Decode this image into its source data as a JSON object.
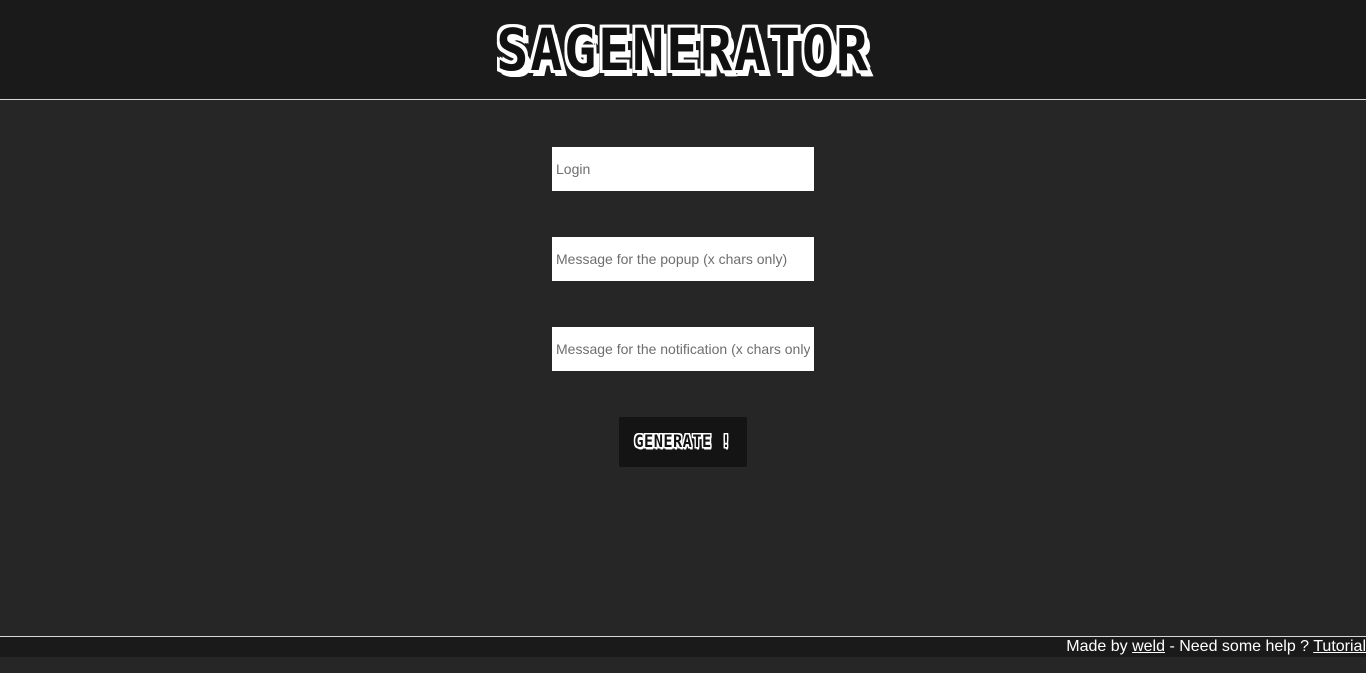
{
  "header": {
    "logo_text": "SAGENERATOR"
  },
  "form": {
    "login_placeholder": "Login",
    "popup_placeholder": "Message for the popup (x chars only)",
    "notification_placeholder": "Message for the notification (x chars only)",
    "generate_label": "GENERATE !"
  },
  "footer": {
    "made_by": "Made by ",
    "author_link": "weld",
    "help_text": " - Need some help ? ",
    "tutorial_link": "Tutorial"
  },
  "colors": {
    "page_background": "#262626",
    "header_background": "#1a1a1a",
    "button_background": "#141414",
    "text": "#ffffff"
  }
}
